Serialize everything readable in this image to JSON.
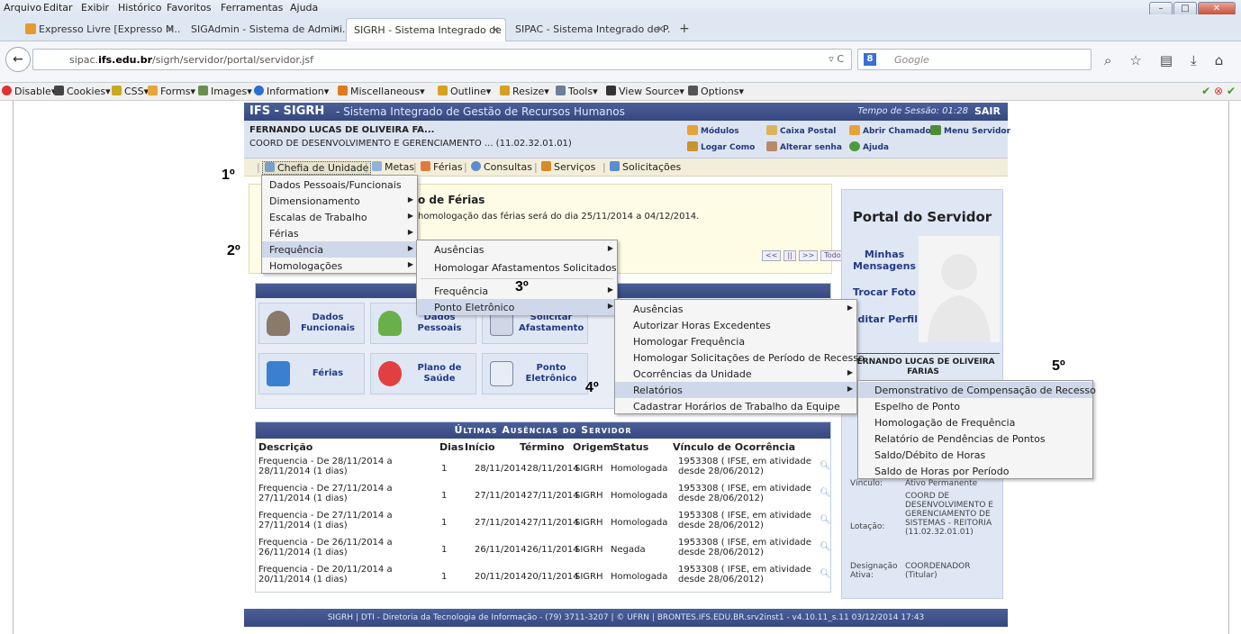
{
  "browser": {
    "menu": [
      "Arquivo",
      "Editar",
      "Exibir",
      "Histórico",
      "Favoritos",
      "Ferramentas",
      "Ajuda"
    ],
    "tabs": [
      {
        "label": "Expresso Livre [Expresso M...",
        "active": false
      },
      {
        "label": "SIGAdmin - Sistema de Admini...",
        "active": false
      },
      {
        "label": "SIGRH - Sistema Integrado de ...",
        "active": true
      },
      {
        "label": "SIPAC - Sistema Integrado de P...",
        "active": false
      }
    ],
    "url_prefix": "sipac.",
    "url_domain": "ifs.edu.br",
    "url_path": "/sigrh/servidor/portal/servidor.jsf",
    "search_placeholder": "Google",
    "devtools": [
      "Disable",
      "Cookies",
      "CSS",
      "Forms",
      "Images",
      "Information",
      "Miscellaneous",
      "Outline",
      "Resize",
      "Tools",
      "View Source",
      "Options"
    ]
  },
  "header": {
    "title": "IFS - SIGRH",
    "subtitle": "- Sistema Integrado de Gestão de Recursos Humanos",
    "session": "Tempo de Sessão: 01:28",
    "logout": "SAIR"
  },
  "user": {
    "name": "FERNANDO LUCAS DE OLIVEIRA FA...",
    "unit": "COORD DE DESENVOLVIMENTO E GERENCIAMENTO ... (11.02.32.01.01)",
    "links": {
      "modulos": "Módulos",
      "caixa_postal": "Caixa Postal",
      "abrir_chamado": "Abrir Chamado",
      "menu_servidor": "Menu Servidor",
      "logar_como": "Logar Como",
      "alterar_senha": "Alterar senha",
      "ajuda": "Ajuda"
    }
  },
  "topmenu": [
    "Chefia de Unidade",
    "Metas",
    "Férias",
    "Consultas",
    "Serviços",
    "Solicitações"
  ],
  "steps": [
    "1º",
    "2º",
    "3º",
    "4º",
    "5º"
  ],
  "ferias": {
    "title": "o de Férias",
    "text": "homologação das férias será do dia 25/11/2014 a 04/12/2014."
  },
  "pager": [
    "<<",
    "||",
    ">>",
    "Todos"
  ],
  "menu1": [
    "Dados Pessoais/Funcionais",
    "Dimensionamento",
    "Escalas de Trabalho",
    "Férias",
    "Frequência",
    "Homologações"
  ],
  "menu2": [
    "Ausências",
    "Homologar Afastamentos Solicitados",
    "Frequência",
    "Ponto Eletrônico"
  ],
  "menu3": [
    "Ausências",
    "Autorizar Horas Excedentes",
    "Homologar Frequência",
    "Homologar Solicitações de Período de Recesso",
    "Ocorrências da Unidade",
    "Relatórios",
    "Cadastrar Horários de Trabalho da Equipe"
  ],
  "menu4": [
    "Demonstrativo de Compensação de Recesso",
    "Espelho de Ponto",
    "Homologação de Frequência",
    "Relatório de Pendências de Pontos",
    "Saldo/Débito de Horas",
    "Saldo de Horas por Período"
  ],
  "tiles": [
    {
      "label": "Dados Funcionais"
    },
    {
      "label": "Dados Pessoais"
    },
    {
      "label": "Solicitar Afastamento"
    },
    {
      "label": "Férias"
    },
    {
      "label": "Plano de Saúde"
    },
    {
      "label": "Ponto Eletrônico"
    }
  ],
  "absences": {
    "title": "Últimas Ausências do Servidor",
    "columns": [
      "Descrição",
      "Dias",
      "Início",
      "Término",
      "Origem",
      "Status",
      "Vínculo de Ocorrência"
    ],
    "rows": [
      {
        "desc": "Frequencia - De 28/11/2014 a 28/11/2014 (1 dias)",
        "dias": "1",
        "inicio": "28/11/2014",
        "termino": "28/11/2014",
        "origem": "SIGRH",
        "status": "Homologada",
        "vinculo": "1953308 ( IFSE, em atividade desde 28/06/2012)"
      },
      {
        "desc": "Frequencia - De 27/11/2014 a 27/11/2014 (1 dias)",
        "dias": "1",
        "inicio": "27/11/2014",
        "termino": "27/11/2014",
        "origem": "SIGRH",
        "status": "Homologada",
        "vinculo": "1953308 ( IFSE, em atividade desde 28/06/2012)"
      },
      {
        "desc": "Frequencia - De 27/11/2014 a 27/11/2014 (1 dias)",
        "dias": "1",
        "inicio": "27/11/2014",
        "termino": "27/11/2014",
        "origem": "SIGRH",
        "status": "Homologada",
        "vinculo": "1953308 ( IFSE, em atividade desde 28/06/2012)"
      },
      {
        "desc": "Frequencia - De 26/11/2014 a 26/11/2014 (1 dias)",
        "dias": "1",
        "inicio": "26/11/2014",
        "termino": "26/11/2014",
        "origem": "SIGRH",
        "status": "Negada",
        "vinculo": "1953308 ( IFSE, em atividade desde 28/06/2012)"
      },
      {
        "desc": "Frequencia - De 20/11/2014 a 20/11/2014 (1 dias)",
        "dias": "1",
        "inicio": "20/11/2014",
        "termino": "20/11/2014",
        "origem": "SIGRH",
        "status": "Homologada",
        "vinculo": "1953308 ( IFSE, em atividade desde 28/06/2012)"
      }
    ]
  },
  "portal": {
    "title": "Portal do Servidor",
    "minhas_mensagens": "Minhas Mensagens",
    "trocar_foto": "Trocar Foto",
    "editar_perfil": "Editar Perfil",
    "server_name": "FERNANDO LUCAS DE OLIVEIRA FARIAS",
    "vinculo_label": "Vínculo:",
    "vinculo_value": "Ativo Permanente",
    "lotacao_label": "Lotação:",
    "lotacao_value": "COORD DE DESENVOLVIMENTO E GERENCIAMENTO DE SISTEMAS - REITORIA (11.02.32.01.01)",
    "designacao_label": "Designação Ativa:",
    "designacao_value": "COORDENADOR (Titular)"
  },
  "footer": "SIGRH | DTI - Diretoria da Tecnologia de Informação - (79) 3711-3207 | © UFRN | BRONTES.IFS.EDU.BR.srv2inst1 - v4.10.11_s.11 03/12/2014 17:43"
}
